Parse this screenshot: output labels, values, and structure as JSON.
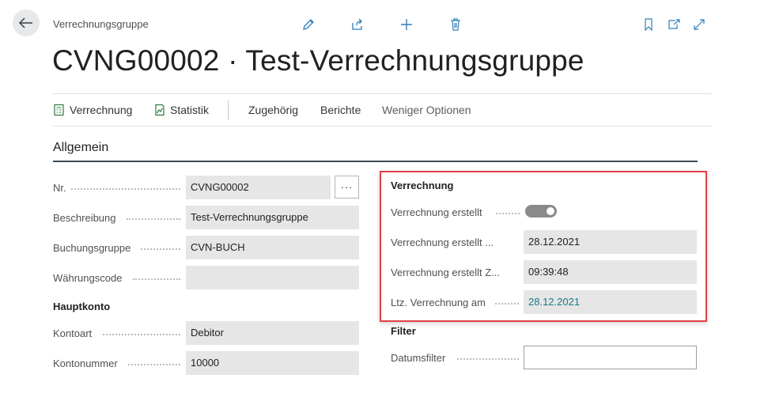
{
  "breadcrumb": "Verrechnungsgruppe",
  "page_title": "CVNG00002 · Test-Verrechnungsgruppe",
  "actions": {
    "verrechnung": "Verrechnung",
    "statistik": "Statistik",
    "zugehoerig": "Zugehörig",
    "berichte": "Berichte",
    "weniger_optionen": "Weniger Optionen"
  },
  "section_title": "Allgemein",
  "fields": {
    "nr": {
      "label": "Nr.",
      "value": "CVNG00002"
    },
    "beschreibung": {
      "label": "Beschreibung",
      "value": "Test-Verrechnungsgruppe"
    },
    "buchungsgruppe": {
      "label": "Buchungsgruppe",
      "value": "CVN-BUCH"
    },
    "waehrungscode": {
      "label": "Währungscode",
      "value": ""
    },
    "kontoart": {
      "label": "Kontoart",
      "value": "Debitor"
    },
    "kontonummer": {
      "label": "Kontonummer",
      "value": "10000"
    }
  },
  "hauptkonto_heading": "Hauptkonto",
  "ellipsis_label": "···",
  "verrechnung": {
    "heading": "Verrechnung",
    "erstellt": {
      "label": "Verrechnung erstellt",
      "value": true
    },
    "erstellt_am": {
      "label": "Verrechnung erstellt ...",
      "value": "28.12.2021"
    },
    "erstellt_zeit": {
      "label": "Verrechnung erstellt Z...",
      "value": "09:39:48"
    },
    "letzte": {
      "label": "Ltz. Verrechnung am",
      "value": "28.12.2021"
    }
  },
  "filter": {
    "heading": "Filter",
    "datumsfilter": {
      "label": "Datumsfilter",
      "value": ""
    }
  },
  "colors": {
    "accent_link": "#1a7a87",
    "highlight_border": "#e04048",
    "icon_blue": "#2f7fb8"
  }
}
